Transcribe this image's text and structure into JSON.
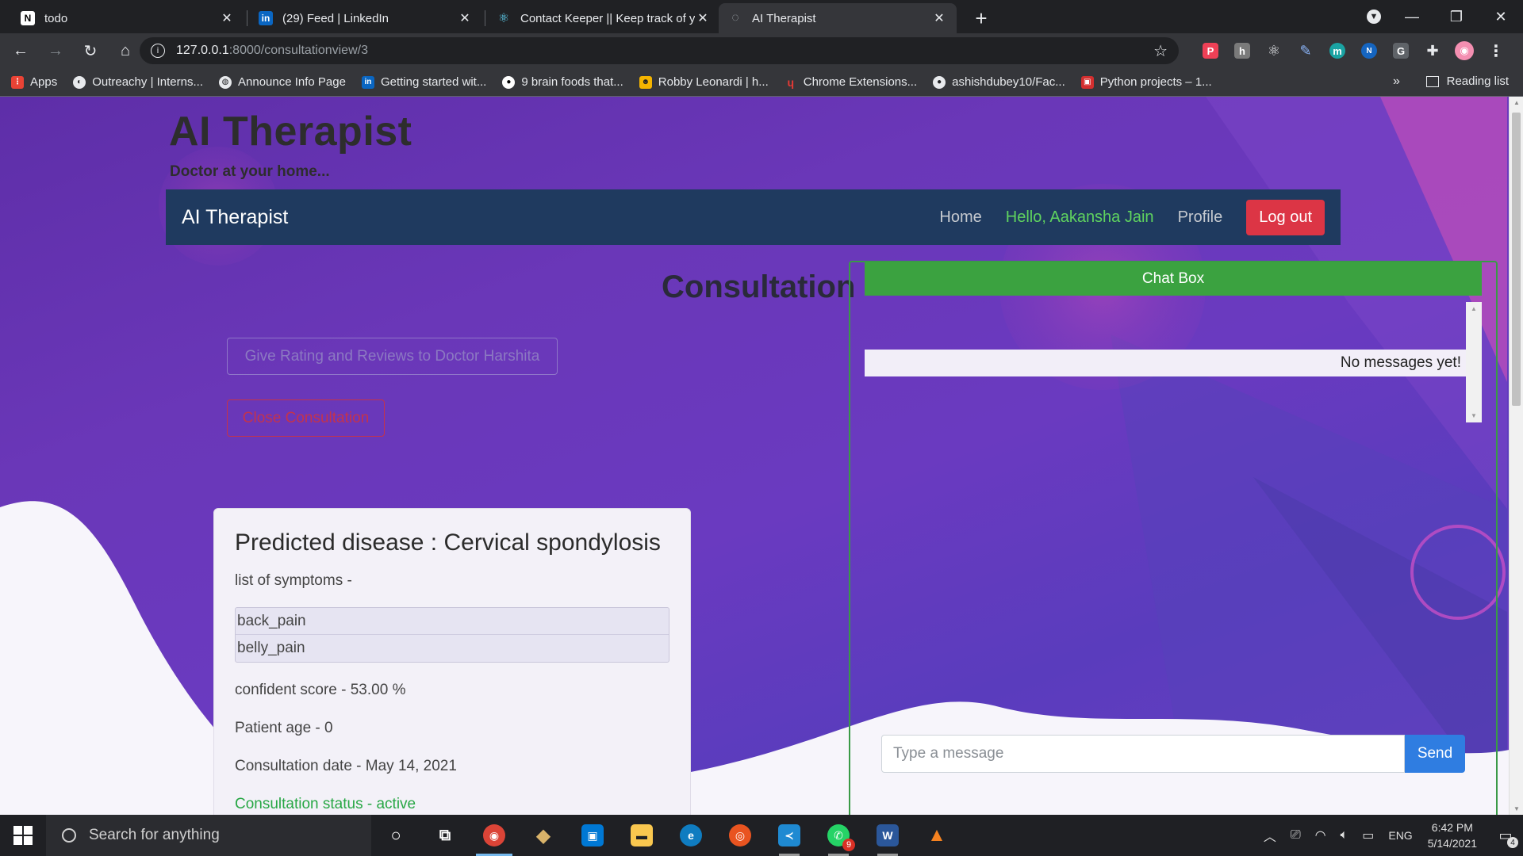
{
  "browser": {
    "tabs": [
      {
        "title": "todo",
        "icon": "notion-icon",
        "icon_char": "N",
        "icon_bg": "#ffffff",
        "icon_fg": "#000000"
      },
      {
        "title": "(29) Feed | LinkedIn",
        "icon": "linkedin-icon",
        "icon_char": "in",
        "icon_bg": "#0a66c2",
        "icon_fg": "#ffffff"
      },
      {
        "title": "Contact Keeper || Keep track of yo",
        "icon": "react-icon",
        "icon_char": "⚛",
        "icon_bg": "transparent",
        "icon_fg": "#61dafb"
      },
      {
        "title": "AI Therapist",
        "icon": "globe-icon",
        "icon_char": "◌",
        "icon_bg": "transparent",
        "icon_fg": "#9aa0a6"
      }
    ],
    "new_tab_label": "+",
    "address": {
      "host": "127.0.0.1",
      "path": ":8000/consultationview/3"
    },
    "extensions": [
      {
        "name": "pocket-icon",
        "char": "P",
        "bg": "#ef4056"
      },
      {
        "name": "hypothesis-icon",
        "char": "h",
        "bg": "#7a7a7a"
      },
      {
        "name": "react-devtools-icon",
        "char": "⚛",
        "bg": "transparent"
      },
      {
        "name": "pen-icon",
        "char": "✎",
        "bg": "transparent"
      },
      {
        "name": "m-extension-icon",
        "char": "m",
        "bg": "#1aa3a3"
      },
      {
        "name": "new-extension-icon",
        "char": "N",
        "bg": "#1565c0"
      },
      {
        "name": "g-extension-icon",
        "char": "G",
        "bg": "#5f6368"
      },
      {
        "name": "puzzle-icon",
        "char": "✚",
        "bg": "transparent"
      },
      {
        "name": "profile-avatar-icon",
        "char": "◉",
        "bg": "#f48fb1"
      },
      {
        "name": "menu-dots-icon",
        "char": "⋮",
        "bg": "transparent"
      }
    ],
    "bookmarks": [
      {
        "label": "Apps",
        "icon": "apps-grid-icon",
        "color": "#ea4335"
      },
      {
        "label": "Outreachy | Interns...",
        "icon": "outreachy-icon",
        "color": "#e8eaed"
      },
      {
        "label": "Announce Info Page",
        "icon": "globe-icon",
        "color": "#e8eaed"
      },
      {
        "label": "Getting started wit...",
        "icon": "linkedin-icon",
        "color": "#0a66c2"
      },
      {
        "label": "9 brain foods that...",
        "icon": "panda-icon",
        "color": "#ffffff"
      },
      {
        "label": "Robby Leonardi | h...",
        "icon": "robby-icon",
        "color": "#f4b400"
      },
      {
        "label": "Chrome Extensions...",
        "icon": "script-icon",
        "color": "#c62828"
      },
      {
        "label": "ashishdubey10/Fac...",
        "icon": "github-icon",
        "color": "#ffffff"
      },
      {
        "label": "Python projects – 1...",
        "icon": "slides-icon",
        "color": "#d32f2f"
      }
    ],
    "bookmarks_more": "»",
    "reading_list": "Reading list"
  },
  "page": {
    "site_title": "AI Therapist",
    "site_tagline": "Doctor at your home...",
    "navbar": {
      "brand": "AI Therapist",
      "home": "Home",
      "greeting": "Hello, Aakansha Jain",
      "profile": "Profile",
      "logout": "Log out"
    },
    "consultation_heading": "Consultation",
    "rating_button": "Give Rating and Reviews to Doctor Harshita",
    "close_button": "Close Consultation",
    "card": {
      "title": "Predicted disease : Cervical spondylosis",
      "symptoms_label": "list of symptoms -",
      "symptoms": [
        "back_pain",
        "belly_pain"
      ],
      "confidence": "confident score - 53.00 %",
      "patient_age": "Patient age - 0",
      "consultation_date": "Consultation date - May 14, 2021",
      "status": "Consultation status - active"
    },
    "chat": {
      "header": "Chat Box",
      "empty_message": "No messages yet!",
      "input_placeholder": "Type a message",
      "send": "Send"
    }
  },
  "taskbar": {
    "search_placeholder": "Search for anything",
    "apps": [
      {
        "name": "cortana-icon",
        "char": "○",
        "bg": "transparent",
        "state": ""
      },
      {
        "name": "task-view-icon",
        "char": "⧉",
        "bg": "transparent",
        "state": ""
      },
      {
        "name": "chrome-icon",
        "char": "◉",
        "bg": "#db4437",
        "state": "active"
      },
      {
        "name": "git-icon",
        "char": "◆",
        "bg": "transparent",
        "state": ""
      },
      {
        "name": "store-icon",
        "char": "▣",
        "bg": "#0078d4",
        "state": ""
      },
      {
        "name": "file-explorer-icon",
        "char": "▬",
        "bg": "#f9c74f",
        "state": ""
      },
      {
        "name": "edge-icon",
        "char": "e",
        "bg": "#0f7cc0",
        "state": ""
      },
      {
        "name": "ubuntu-icon",
        "char": "◎",
        "bg": "#e95420",
        "state": ""
      },
      {
        "name": "vscode-icon",
        "char": "≺",
        "bg": "#1f8ad2",
        "state": "running"
      },
      {
        "name": "whatsapp-icon",
        "char": "✆",
        "bg": "#25d366",
        "state": "running",
        "badge": "9"
      },
      {
        "name": "word-icon",
        "char": "W",
        "bg": "#2b579a",
        "state": "running"
      },
      {
        "name": "vlc-icon",
        "char": "▲",
        "bg": "transparent",
        "state": ""
      }
    ],
    "tray": {
      "language": "ENG",
      "time": "6:42 PM",
      "date": "5/14/2021",
      "notifications": "4"
    }
  }
}
